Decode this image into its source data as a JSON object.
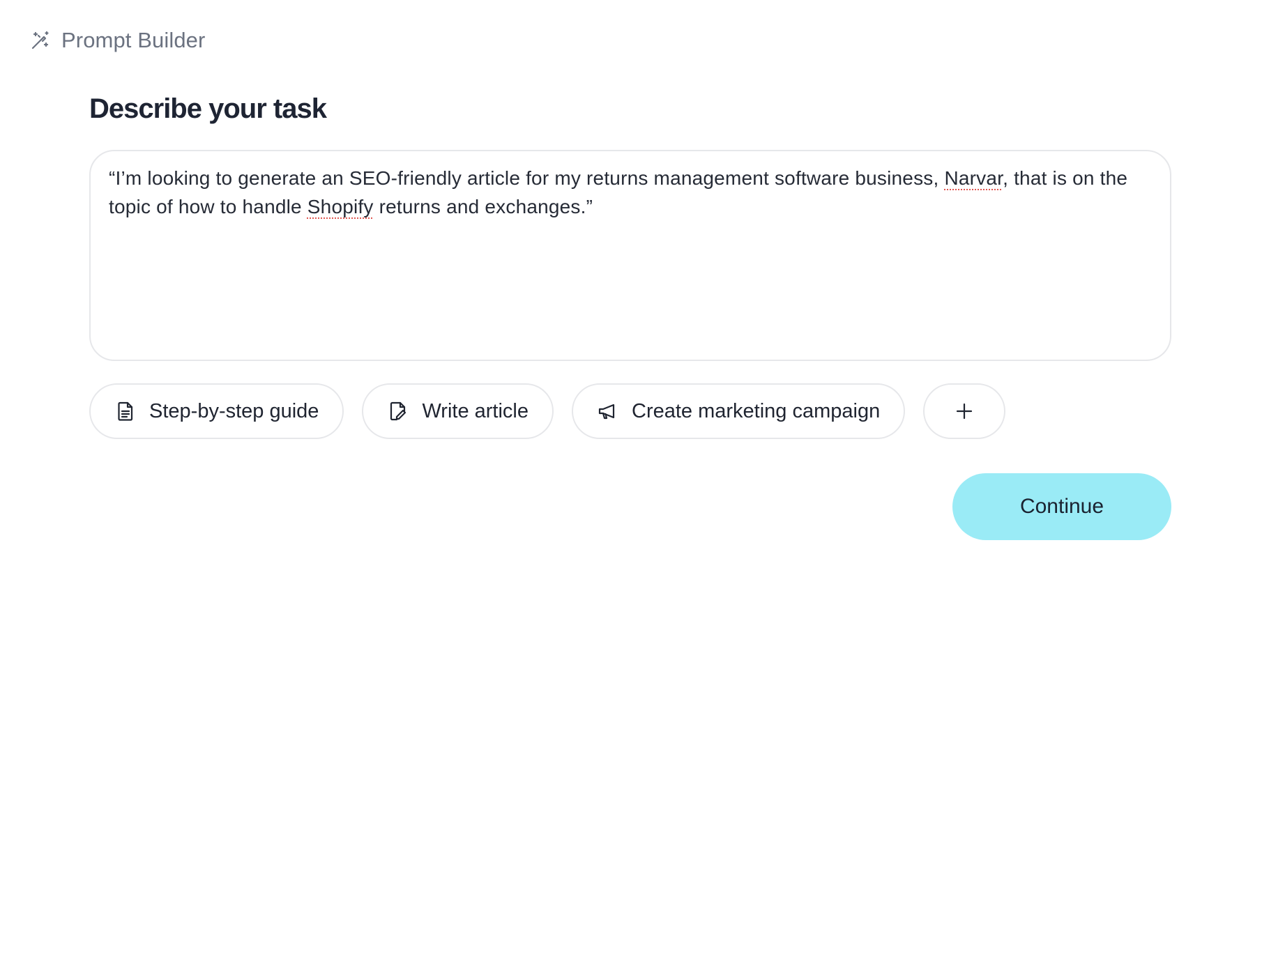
{
  "header": {
    "app_title": "Prompt Builder",
    "icon": "magic-wand-icon"
  },
  "main": {
    "title": "Describe your task",
    "task_text": {
      "part1": "“I’m looking to generate an SEO-friendly article for my returns management software business, ",
      "word1": "Narvar",
      "part2": ", that is on the topic of how to handle ",
      "word2": "Shopify",
      "part3": " returns and exchanges.”"
    },
    "chips": [
      {
        "label": "Step-by-step guide",
        "icon": "document-icon"
      },
      {
        "label": "Write article",
        "icon": "document-pen-icon"
      },
      {
        "label": "Create marketing campaign",
        "icon": "megaphone-icon"
      },
      {
        "label": "+",
        "icon": "plus-icon"
      }
    ],
    "continue_label": "Continue"
  },
  "colors": {
    "continue_bg": "#9aebf6",
    "border": "#e6e7ea",
    "spellcheck": "#e0554f"
  }
}
